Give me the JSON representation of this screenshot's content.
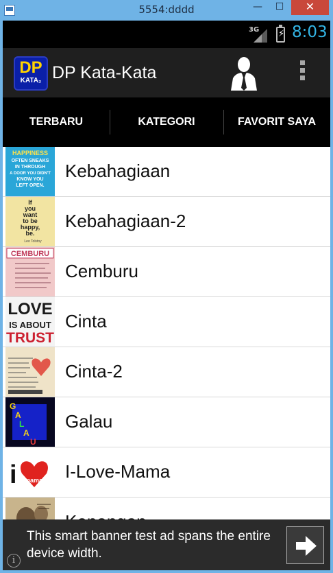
{
  "window": {
    "title": "5554:dddd",
    "minimize_glyph": "—",
    "maximize_glyph": "☐",
    "close_glyph": "✕"
  },
  "statusbar": {
    "network": "3G",
    "time": "8:03"
  },
  "actionbar": {
    "logo_dp": "DP",
    "logo_kata": "KATA₂",
    "title": "DP Kata-Kata",
    "profile_icon": "user-tie-icon",
    "overflow_icon": "overflow-menu-icon"
  },
  "tabs": [
    {
      "label": "TERBARU",
      "selected": false
    },
    {
      "label": "KATEGORI",
      "selected": true
    },
    {
      "label": "FAVORIT SAYA",
      "selected": false
    }
  ],
  "categories": [
    {
      "label": "Kebahagiaan",
      "thumb_text": [
        "HAPPINESS",
        "OFTEN SNEAKS",
        "IN THROUGH",
        "A DOOR YOU DIDN'T",
        "KNOW YOU",
        "LEFT OPEN."
      ]
    },
    {
      "label": "Kebahagiaan-2",
      "thumb_text": [
        "If",
        "you",
        "want",
        "to be",
        "happy,",
        "be.",
        "Leo Tolstoy"
      ]
    },
    {
      "label": "Cemburu",
      "thumb_text": [
        "CEMBURU"
      ]
    },
    {
      "label": "Cinta",
      "thumb_text": [
        "LOVE",
        "IS ABOUT",
        "TRUST"
      ]
    },
    {
      "label": "Cinta-2",
      "thumb_text": []
    },
    {
      "label": "Galau",
      "thumb_text": [
        "G",
        "A",
        "L",
        "A",
        "U"
      ]
    },
    {
      "label": "I-Love-Mama",
      "thumb_text": [
        "i",
        "mama"
      ]
    },
    {
      "label": "Kenangan",
      "thumb_text": []
    }
  ],
  "ad": {
    "text": "This smart banner test ad spans the entire device width.",
    "arrow_icon": "arrow-right-icon",
    "info_glyph": "i"
  },
  "colors": {
    "accent": "#33b5e5",
    "actionbar": "#1f1f1f",
    "tabbar": "#000000",
    "window_chrome": "#6fb3e6"
  }
}
